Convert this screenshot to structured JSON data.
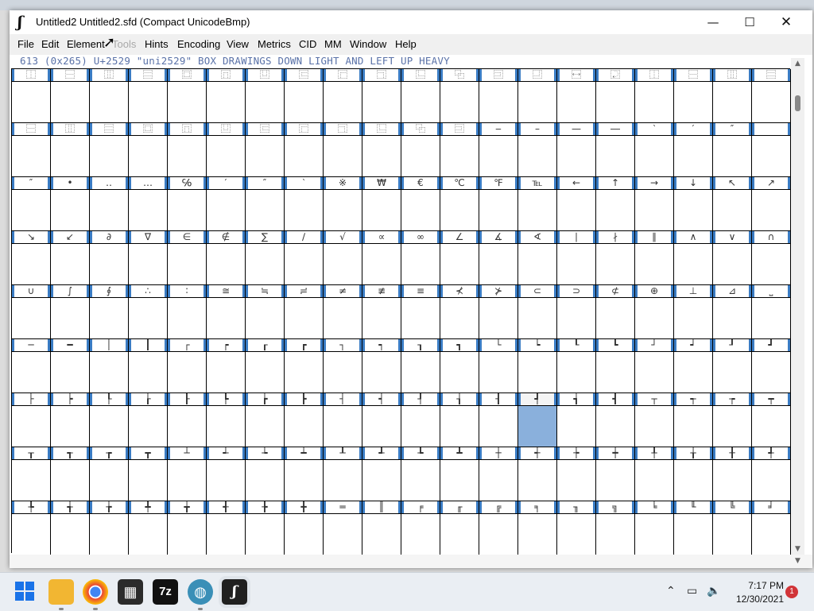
{
  "window": {
    "title": "Untitled2  Untitled2.sfd (Compact UnicodeBmp)",
    "app_icon": "fontforge-icon",
    "minimize": "—",
    "maximize": "☐",
    "close": "✕"
  },
  "menu": [
    {
      "label": "File",
      "enabled": true
    },
    {
      "label": "Edit",
      "enabled": true
    },
    {
      "label": "Element",
      "enabled": true
    },
    {
      "label": "Tools",
      "enabled": false
    },
    {
      "label": "Hints",
      "enabled": true
    },
    {
      "label": "Encoding",
      "enabled": true
    },
    {
      "label": "View",
      "enabled": true
    },
    {
      "label": "Metrics",
      "enabled": true
    },
    {
      "label": "CID",
      "enabled": true
    },
    {
      "label": "MM",
      "enabled": true
    },
    {
      "label": "Window",
      "enabled": true
    },
    {
      "label": "Help",
      "enabled": true
    }
  ],
  "info_line": "613 (0x265) U+2529 \"uni2529\" BOX DRAWINGS DOWN LIGHT AND LEFT UP HEAVY",
  "grid": {
    "selected_row": 6,
    "selected_col": 13,
    "rows": [
      [
        "⿰",
        "⿱",
        "⿲",
        "⿳",
        "⿴",
        "⿵",
        "⿶",
        "⿷",
        "⿸",
        "⿹",
        "⿺",
        "⿻",
        "⿼",
        "⿽",
        "⿾",
        "⿿",
        "⿰",
        "⿱",
        "⿲",
        "⿳"
      ],
      [
        "⿱",
        "⿲",
        "⿳",
        "⿴",
        "⿵",
        "⿶",
        "⿷",
        "⿸",
        "⿹",
        "⿺",
        "⿻",
        "⿼",
        "‒",
        "–",
        "—",
        "―",
        "‵",
        "′",
        "″",
        ""
      ],
      [
        "″",
        "•",
        "‥",
        "…",
        "℅",
        "′",
        "″",
        "‵",
        "※",
        "₩",
        "€",
        "℃",
        "℉",
        "℡",
        "←",
        "↑",
        "→",
        "↓",
        "↖",
        "↗"
      ],
      [
        "↘",
        "↙",
        "∂",
        "∇",
        "∈",
        "∉",
        "∑",
        "∕",
        "√",
        "∝",
        "∞",
        "∠",
        "∡",
        "∢",
        "∣",
        "∤",
        "∥",
        "∧",
        "∨",
        "∩"
      ],
      [
        "∪",
        "∫",
        "∮",
        "∴",
        "∶",
        "≅",
        "≒",
        "≓",
        "≠",
        "≢",
        "≡",
        "⊀",
        "⊁",
        "⊂",
        "⊃",
        "⊄",
        "⊕",
        "⊥",
        "⊿",
        "⎵"
      ],
      [
        "─",
        "━",
        "│",
        "┃",
        "┌",
        "┍",
        "┎",
        "┏",
        "┐",
        "┑",
        "┒",
        "┓",
        "└",
        "┕",
        "┖",
        "┗",
        "┘",
        "┙",
        "┚",
        "┛"
      ],
      [
        "├",
        "┝",
        "┞",
        "┟",
        "┠",
        "┡",
        "┢",
        "┣",
        "┤",
        "┥",
        "┦",
        "┧",
        "┨",
        "┩",
        "┪",
        "┫",
        "┬",
        "┭",
        "┮",
        "┯"
      ],
      [
        "┰",
        "┱",
        "┲",
        "┳",
        "┴",
        "┵",
        "┶",
        "┷",
        "┸",
        "┹",
        "┺",
        "┻",
        "┼",
        "┽",
        "┾",
        "┿",
        "╀",
        "╁",
        "╂",
        "╃"
      ],
      [
        "╄",
        "╅",
        "╆",
        "╇",
        "╈",
        "╉",
        "╊",
        "╋",
        "═",
        "║",
        "╒",
        "╓",
        "╔",
        "╕",
        "╖",
        "╗",
        "╘",
        "╙",
        "╚",
        "╛"
      ]
    ]
  },
  "taskbar": {
    "apps": [
      {
        "name": "start-icon",
        "label": ""
      },
      {
        "name": "file-explorer-icon",
        "label": ""
      },
      {
        "name": "chrome-icon",
        "label": ""
      },
      {
        "name": "store-icon",
        "label": ""
      },
      {
        "name": "7zip-icon",
        "label": "7z"
      },
      {
        "name": "globe-app-icon",
        "label": ""
      },
      {
        "name": "fontforge-taskbar-icon",
        "label": "ʃ"
      }
    ],
    "clock_time": "7:17 PM",
    "clock_date": "12/30/2021",
    "notification_count": "1"
  }
}
